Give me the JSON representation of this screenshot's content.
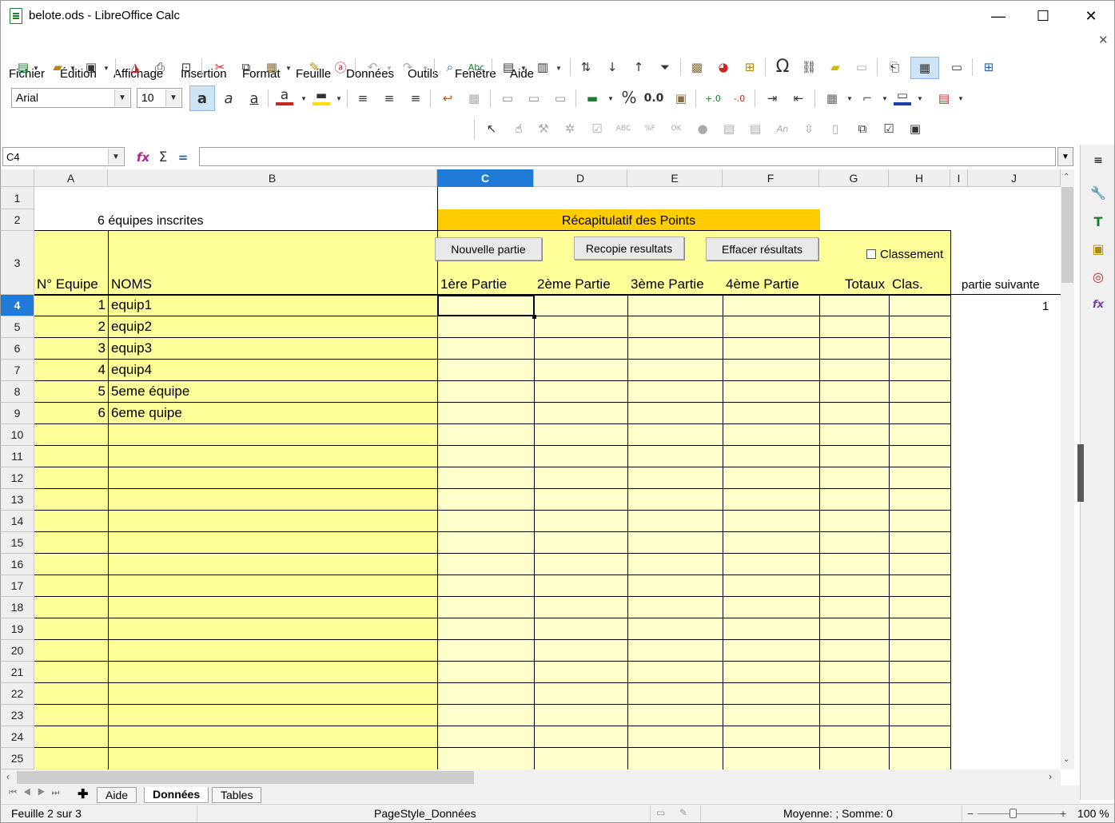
{
  "window": {
    "title": "belote.ods - LibreOffice Calc",
    "minimize": "—",
    "maximize": "☐",
    "close": "✕"
  },
  "menu": [
    "Fichier",
    "Édition",
    "Affichage",
    "Insertion",
    "Format",
    "Feuille",
    "Données",
    "Outils",
    "Fenêtre",
    "Aide"
  ],
  "format_toolbar": {
    "font_name": "Arial",
    "font_size": "10",
    "percent": "%",
    "decimal": "0.0",
    "omega": "Ω"
  },
  "formula_bar": {
    "name_box": "C4",
    "formula": ""
  },
  "columns": [
    {
      "label": "A",
      "selected": false
    },
    {
      "label": "B",
      "selected": false
    },
    {
      "label": "C",
      "selected": true
    },
    {
      "label": "D",
      "selected": false
    },
    {
      "label": "E",
      "selected": false
    },
    {
      "label": "F",
      "selected": false
    },
    {
      "label": "G",
      "selected": false
    },
    {
      "label": "H",
      "selected": false
    },
    {
      "label": "I",
      "selected": false
    },
    {
      "label": "J",
      "selected": false
    }
  ],
  "rows": [
    "1",
    "2",
    "3",
    "4",
    "5",
    "6",
    "7",
    "8",
    "9",
    "10",
    "11",
    "12",
    "13",
    "14",
    "15",
    "16",
    "17",
    "18",
    "19",
    "20",
    "21",
    "22",
    "23",
    "24",
    "25"
  ],
  "selected_row": "4",
  "sheet": {
    "b2": "6 équipes inscrites",
    "recap_title": "Récapitulatif des Points",
    "hdr_a": "N° Equipe",
    "hdr_b": "NOMS",
    "hdr_c": "1ère Partie",
    "hdr_d": "2ème Partie",
    "hdr_e": "3ème Partie",
    "hdr_f": "4ème Partie",
    "hdr_g": "Totaux",
    "hdr_h": "Clas.",
    "hdr_j": "partie suivante",
    "j4": "1",
    "teams": [
      {
        "num": "1",
        "name": "equip1"
      },
      {
        "num": "2",
        "name": "equip2"
      },
      {
        "num": "3",
        "name": "equip3"
      },
      {
        "num": "4",
        "name": "equip4"
      },
      {
        "num": "5",
        "name": "5eme équipe"
      },
      {
        "num": "6",
        "name": "6eme quipe"
      }
    ],
    "btn_new": "Nouvelle partie",
    "btn_copy": "Recopie resultats",
    "btn_clear": "Effacer résultats",
    "checkbox_label": "Classement",
    "checkbox_checked": false,
    "recap_color": "#ffcc00",
    "yellow_color": "#ffff99",
    "light_yellow_color": "#ffffcc"
  },
  "tabs": [
    "Aide",
    "Données",
    "Tables"
  ],
  "active_tab": "Données",
  "status": {
    "sheet": "Feuille 2 sur 3",
    "page_style": "PageStyle_Données",
    "summary": "Moyenne: ; Somme: 0",
    "zoom": "100 %"
  }
}
